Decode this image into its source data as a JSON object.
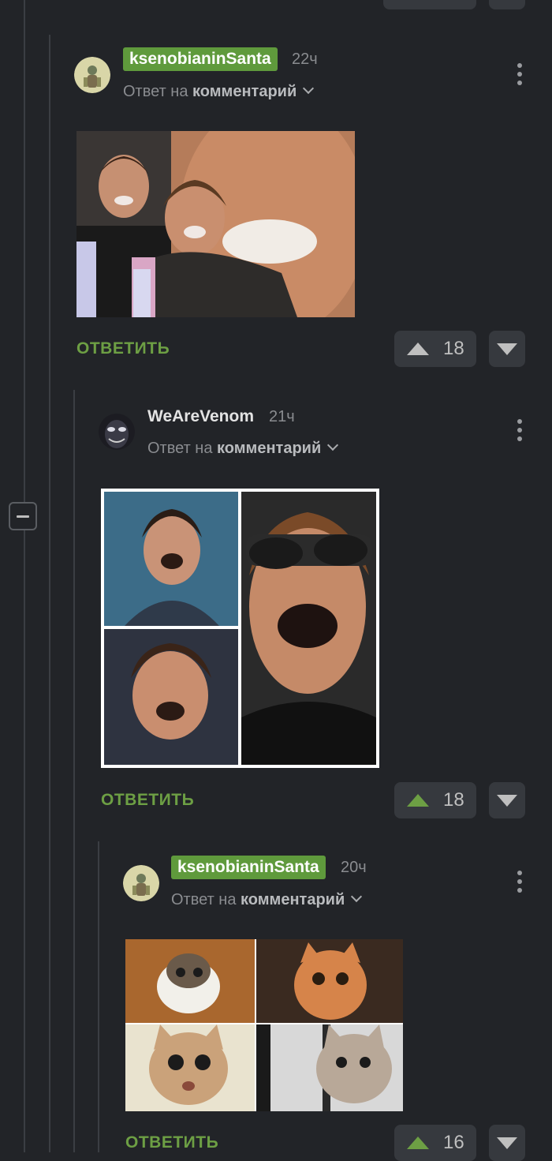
{
  "colors": {
    "background": "#222428",
    "badge_green": "#5f9a3c",
    "reply_green": "#6d9f44",
    "button_bg": "#36393e"
  },
  "comments": [
    {
      "author": "ksenobianinSanta",
      "author_badge": true,
      "time": "22ч",
      "reply_prefix": "Ответ на",
      "reply_target": "комментарий",
      "image_icon": "laughing-men-collage-image",
      "reply_label": "ОТВЕТИТЬ",
      "votes": "18",
      "upvoted": false
    },
    {
      "author": "WeAreVenom",
      "author_badge": false,
      "time": "21ч",
      "reply_prefix": "Ответ на",
      "reply_target": "комментарий",
      "image_icon": "laughing-faces-grid-image",
      "reply_label": "ОТВЕТИТЬ",
      "votes": "18",
      "upvoted": true
    },
    {
      "author": "ksenobianinSanta",
      "author_badge": true,
      "time": "20ч",
      "reply_prefix": "Ответ на",
      "reply_target": "комментарий",
      "image_icon": "surprised-cats-grid-image",
      "reply_label": "ОТВЕТИТЬ",
      "votes": "16",
      "upvoted": true
    }
  ]
}
